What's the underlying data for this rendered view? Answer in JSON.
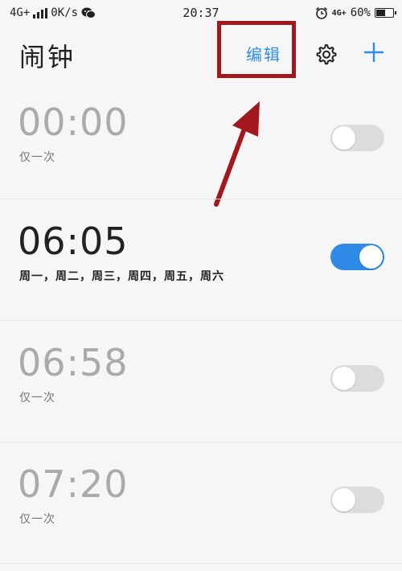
{
  "status_bar": {
    "network": "4G+",
    "speed": "0K/s",
    "time": "20:37",
    "network_secondary": "4G+",
    "battery": "60%",
    "battery_level": 0.6,
    "icons": [
      "signal-icon",
      "wechat-icon",
      "alarm-clock-icon",
      "battery-icon"
    ]
  },
  "header": {
    "title": "闹钟",
    "edit_label": "编辑",
    "icons": [
      "gear-icon",
      "plus-icon"
    ],
    "accent_color": "#2f8ee8",
    "highlight_color": "#a3171d"
  },
  "alarms": [
    {
      "time": "00:00",
      "repeat": "仅一次",
      "enabled": false
    },
    {
      "time": "06:05",
      "repeat": "周一，周二，周三，周四，周五，周六",
      "enabled": true
    },
    {
      "time": "06:58",
      "repeat": "仅一次",
      "enabled": false
    },
    {
      "time": "07:20",
      "repeat": "仅一次",
      "enabled": false
    }
  ],
  "colors": {
    "toggle_on": "#2e8ae6",
    "toggle_off": "#dcdcdc"
  }
}
